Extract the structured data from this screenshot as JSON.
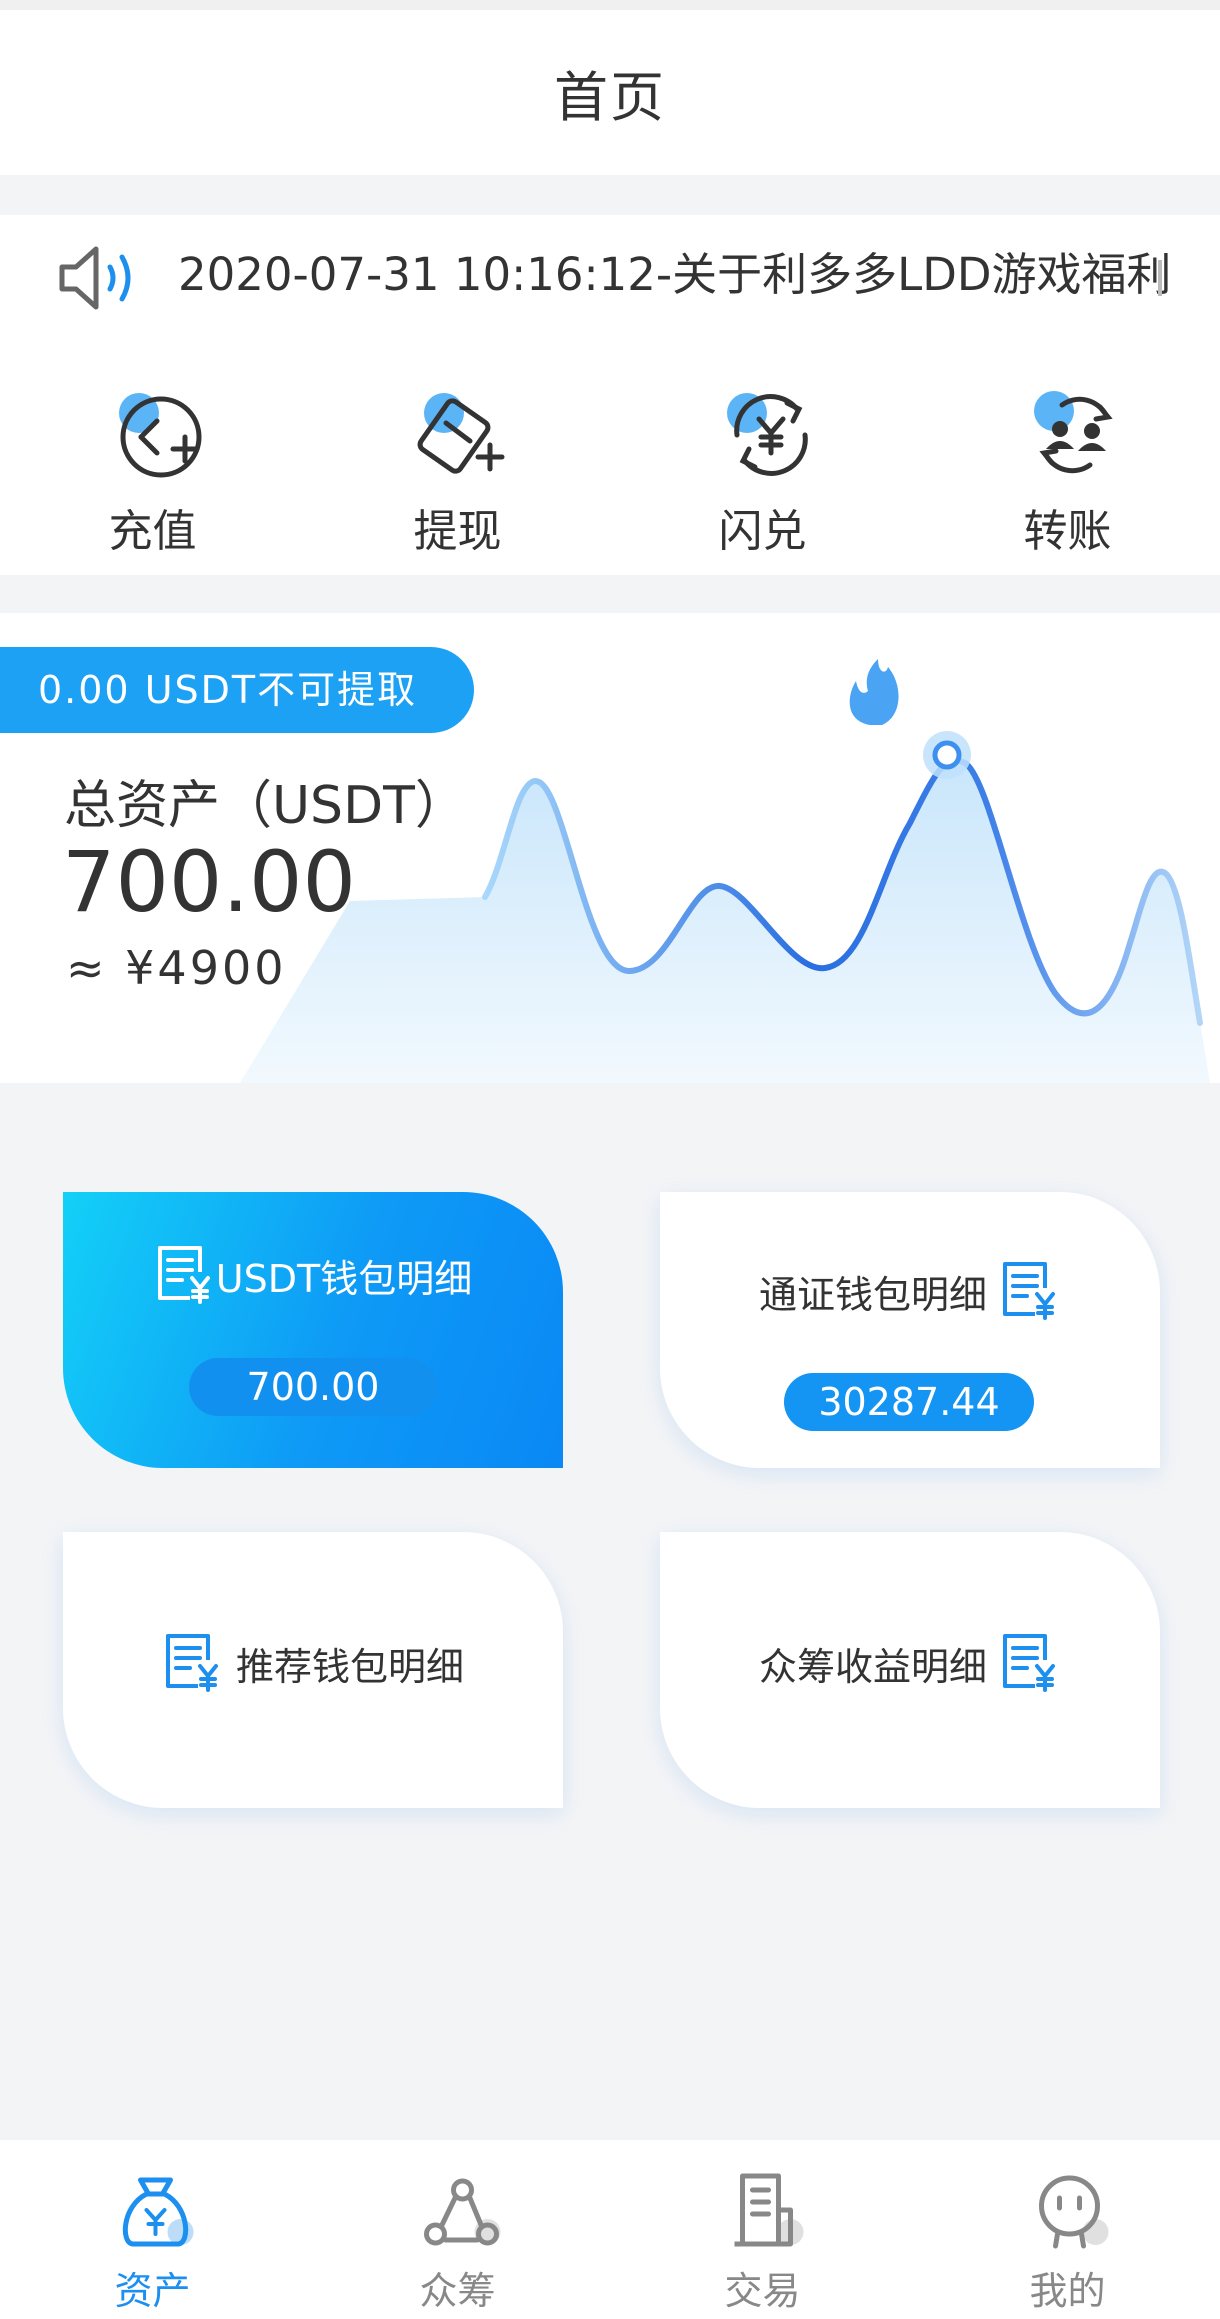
{
  "header": {
    "title": "首页"
  },
  "notice": {
    "text": "2020-07-31 10:16:12-关于利多多LDD游戏福利"
  },
  "quick_actions": [
    {
      "label": "充值",
      "icon": "recharge-icon"
    },
    {
      "label": "提现",
      "icon": "withdraw-icon"
    },
    {
      "label": "闪兑",
      "icon": "flash-exchange-icon"
    },
    {
      "label": "转账",
      "icon": "transfer-icon"
    }
  ],
  "assets": {
    "locked_pill": "0.00 USDT不可提取",
    "total_label": "总资产（USDT）",
    "total_value": "700.00",
    "cny_value": "≈ ¥4900"
  },
  "wallets": [
    {
      "title": "USDT钱包明细",
      "amount": "700.00"
    },
    {
      "title": "通证钱包明细",
      "amount": "30287.44"
    },
    {
      "title": "推荐钱包明细"
    },
    {
      "title": "众筹收益明细"
    }
  ],
  "tabbar": [
    {
      "label": "资产",
      "icon": "money-bag-icon",
      "active": true
    },
    {
      "label": "众筹",
      "icon": "crowdfund-icon",
      "active": false
    },
    {
      "label": "交易",
      "icon": "trade-icon",
      "active": false
    },
    {
      "label": "我的",
      "icon": "profile-icon",
      "active": false
    }
  ],
  "colors": {
    "accent": "#1da1f5",
    "tab_active": "#1c8fef",
    "background": "#f3f4f6"
  }
}
